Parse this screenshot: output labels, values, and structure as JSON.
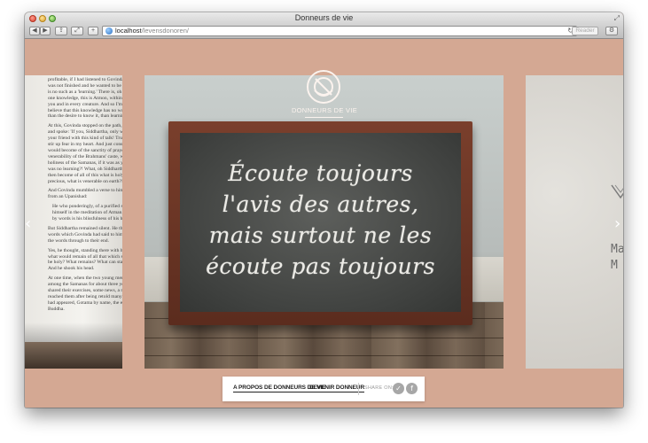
{
  "window": {
    "title": "Donneurs de vie"
  },
  "toolbar": {
    "back_icon": "back-arrow-icon",
    "forward_icon": "forward-arrow-icon",
    "url_host": "localhost",
    "url_path": "/levensdonoren/",
    "reader_label": "Reader"
  },
  "logo": {
    "text": "DONNEURS DE VIE"
  },
  "slide_main": {
    "lines": [
      "Écoute toujours",
      "l'avis des autres,",
      "mais surtout ne les",
      "écoute pas toujours"
    ]
  },
  "slide_left": {
    "paragraphs": [
      "profitable, if I had listened to Govinda longer and was not finished and he wanted to be learned! There is no such as a 'learning.' There is, oh my friend, only one knowledge, this is Atmon, within me and within you and in every creature. And so I'm starting to believe that this knowledge has no worser enemy than the desire to know it, than learning.",
      "At this, Govinda stopped on the path, rose his hands, and spoke: 'If you, Siddhartha, only would not bother your friend with this kind of talk! Truly, your words stir up fear in my heart. And just consider: what would become of the sanctity of prayer, what of the venerability of the Brahmans' caste, what of the holiness of the Samanas, if it was as you say, if there was no learning?! What, oh Siddhartha, what would then become of all of this what is holy, what is precious, what is venerable on earth?!'",
      "And Govinda mumbled a verse to himself, a verse from an Upanishad:",
      "He who ponderingly, of a purified spirit, loses himself in the meditation of Atman, unexpressable by words is his blissfulness of his heart.",
      "But Siddhartha remained silent. He thought about the words which Govinda had said to him and thought the words through to their end.",
      "Yes, he thought, standing there with his head low, what would remain of all that which seemed to us to be holy? What remains? What can stand the test? And he shook his head.",
      "At one time, when the two young men had lived among the Samanas for about three years and had shared their exercises, some news, a rumour, a myth reached them after being retold many times: A man had appeared, Gotama by name, the exalted one, the Buddha."
    ]
  },
  "slide_right": {
    "lines": [
      "Ma",
      "M"
    ]
  },
  "nav": {
    "about_label": "A PROPOS DE DONNEURS DE VIE",
    "become_label": "DEVENIR DONNEUR",
    "share_label": "SHARE ON:",
    "twitter_icon": "twitter-icon",
    "facebook_icon": "facebook-icon"
  },
  "colors": {
    "background": "#d4a893",
    "chalkboard": "#484a48",
    "frame": "#6a3524"
  }
}
